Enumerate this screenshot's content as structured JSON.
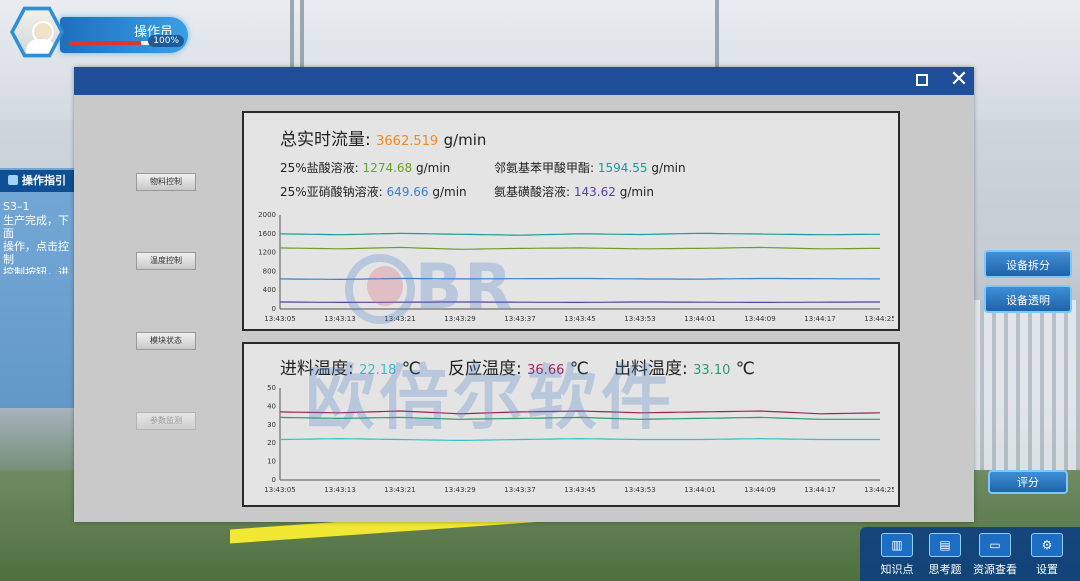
{
  "operator": {
    "name": "操作员",
    "health_pct": 0.83,
    "percent_text": "100%"
  },
  "guide": {
    "title": "操作指引",
    "code": "S3–1",
    "text": "生产完成，下面\n操作，点击控制\n控制按钮，进入\n块。"
  },
  "side_buttons": {
    "disassemble": "设备拆分",
    "transparent": "设备透明",
    "score": "评分"
  },
  "toolbar": {
    "knowledge": {
      "label": "知识点",
      "icon": "book-icon"
    },
    "questions": {
      "label": "思考题",
      "icon": "question-card-icon"
    },
    "resources": {
      "label": "资源查看",
      "icon": "folder-icon"
    },
    "settings": {
      "label": "设置",
      "icon": "gear-icon"
    }
  },
  "modal": {
    "nav": [
      "物料控制",
      "温度控制",
      "模块状态",
      "参数监测"
    ],
    "flow": {
      "title_label": "总实时流量:",
      "title_value": "3662.519",
      "title_unit": "g/min",
      "title_color": "#f08a24",
      "items": [
        {
          "label": "25%盐酸溶液:",
          "value": "1274.68",
          "unit": "g/min",
          "color": "#6a9e2f"
        },
        {
          "label": "邻氨基苯甲酸甲酯:",
          "value": "1594.55",
          "unit": "g/min",
          "color": "#1a9a9a"
        },
        {
          "label": "25%亚硝酸钠溶液:",
          "value": "649.66",
          "unit": "g/min",
          "color": "#3b7fc8"
        },
        {
          "label": "氨基磺酸溶液:",
          "value": "143.62",
          "unit": "g/min",
          "color": "#5a3fa0"
        }
      ]
    },
    "temp": {
      "items": [
        {
          "label": "进料温度:",
          "value": "22.18",
          "unit": "℃",
          "color": "#2ec4c4"
        },
        {
          "label": "反应温度:",
          "value": "36.66",
          "unit": "℃",
          "color": "#a0235a"
        },
        {
          "label": "出料温度:",
          "value": "33.10",
          "unit": "℃",
          "color": "#2e9a6a"
        }
      ]
    }
  },
  "chart_data": [
    {
      "type": "line",
      "x": [
        "13:43:05",
        "13:43:13",
        "13:43:21",
        "13:43:29",
        "13:43:37",
        "13:43:45",
        "13:43:53",
        "13:44:01",
        "13:44:09",
        "13:44:17",
        "13:44:25"
      ],
      "ylim": [
        0,
        2000
      ],
      "yticks": [
        0,
        400,
        800,
        1200,
        1600,
        2000
      ],
      "grid": false,
      "series": [
        {
          "color": "#1a9a9a",
          "values": [
            1600,
            1580,
            1610,
            1590,
            1570,
            1600,
            1585,
            1610,
            1595,
            1580,
            1590
          ]
        },
        {
          "color": "#6a9e2f",
          "values": [
            1300,
            1280,
            1310,
            1270,
            1290,
            1300,
            1280,
            1290,
            1310,
            1280,
            1290
          ]
        },
        {
          "color": "#3b7fc8",
          "values": [
            640,
            630,
            650,
            640,
            645,
            650,
            640,
            635,
            650,
            645,
            640
          ]
        },
        {
          "color": "#5a3fa0",
          "values": [
            150,
            140,
            145,
            150,
            145,
            140,
            150,
            145,
            140,
            145,
            150
          ]
        }
      ]
    },
    {
      "type": "line",
      "x": [
        "13:43:05",
        "13:43:13",
        "13:43:21",
        "13:43:29",
        "13:43:37",
        "13:43:45",
        "13:43:53",
        "13:44:01",
        "13:44:09",
        "13:44:17",
        "13:44:25"
      ],
      "ylim": [
        0,
        50
      ],
      "yticks": [
        0,
        10,
        20,
        30,
        40,
        50
      ],
      "grid": false,
      "series": [
        {
          "color": "#a0235a",
          "values": [
            37,
            36.5,
            37.5,
            36,
            37,
            37.5,
            36.5,
            37,
            37.5,
            36,
            36.5
          ]
        },
        {
          "color": "#2e9a6a",
          "values": [
            34,
            33.5,
            34,
            33,
            33.5,
            34,
            33,
            33.5,
            34,
            33,
            33
          ]
        },
        {
          "color": "#2ec4c4",
          "values": [
            22,
            22.5,
            22,
            21.5,
            22,
            22.5,
            22,
            22,
            22.5,
            22,
            22
          ]
        }
      ]
    }
  ]
}
